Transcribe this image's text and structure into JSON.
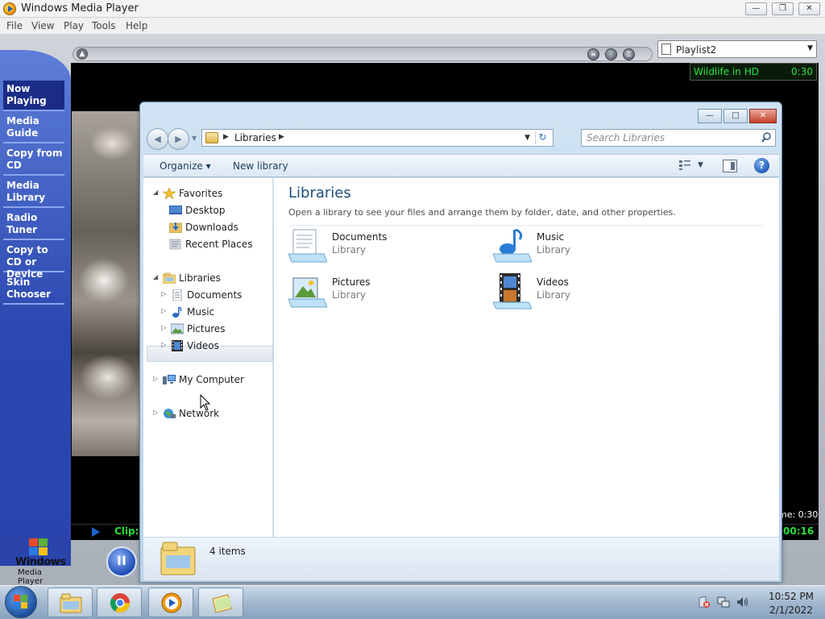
{
  "wmp": {
    "title": "Windows Media Player",
    "menu": [
      "File",
      "View",
      "Play",
      "Tools",
      "Help"
    ],
    "taskpane": [
      "Now Playing",
      "Media Guide",
      "Copy from CD",
      "Media Library",
      "Radio Tuner",
      "Copy to CD or Device",
      "Skin Chooser"
    ],
    "logo_line1": "Windows",
    "logo_line2": "Media Player",
    "playlist": "Playlist2",
    "now_playing_item": {
      "title": "Wildlife in HD",
      "duration": "0:30"
    },
    "time_label": "me: 0:30",
    "clip_label": "Clip: W",
    "clip_time": "00:16",
    "pause_symbol": "II",
    "accent": "#2b47b0",
    "status_green": "#27e23a"
  },
  "explorer": {
    "address": "Libraries",
    "search_placeholder": "Search Libraries",
    "toolbar": {
      "organize": "Organize ▾",
      "new_library": "New library"
    },
    "nav": {
      "favorites": "Favorites",
      "favorites_items": [
        "Desktop",
        "Downloads",
        "Recent Places"
      ],
      "libraries": "Libraries",
      "libraries_items": [
        "Documents",
        "Music",
        "Pictures",
        "Videos"
      ],
      "computer": "My Computer",
      "network": "Network"
    },
    "content": {
      "title": "Libraries",
      "description": "Open a library to see your files and arrange them by folder, date, and other properties.",
      "libraries": [
        {
          "name": "Documents",
          "type": "Library",
          "icon": "documents-icon"
        },
        {
          "name": "Music",
          "type": "Library",
          "icon": "music-icon"
        },
        {
          "name": "Pictures",
          "type": "Library",
          "icon": "pictures-icon"
        },
        {
          "name": "Videos",
          "type": "Library",
          "icon": "videos-icon"
        }
      ]
    },
    "details": {
      "count": "4 items"
    },
    "title_color": "#1f4f7a"
  },
  "taskbar": {
    "apps": [
      "explorer-icon",
      "chrome-icon",
      "media-player-icon",
      "folder-icon"
    ],
    "clock": {
      "time": "10:52 PM",
      "date": "2/1/2022"
    }
  }
}
